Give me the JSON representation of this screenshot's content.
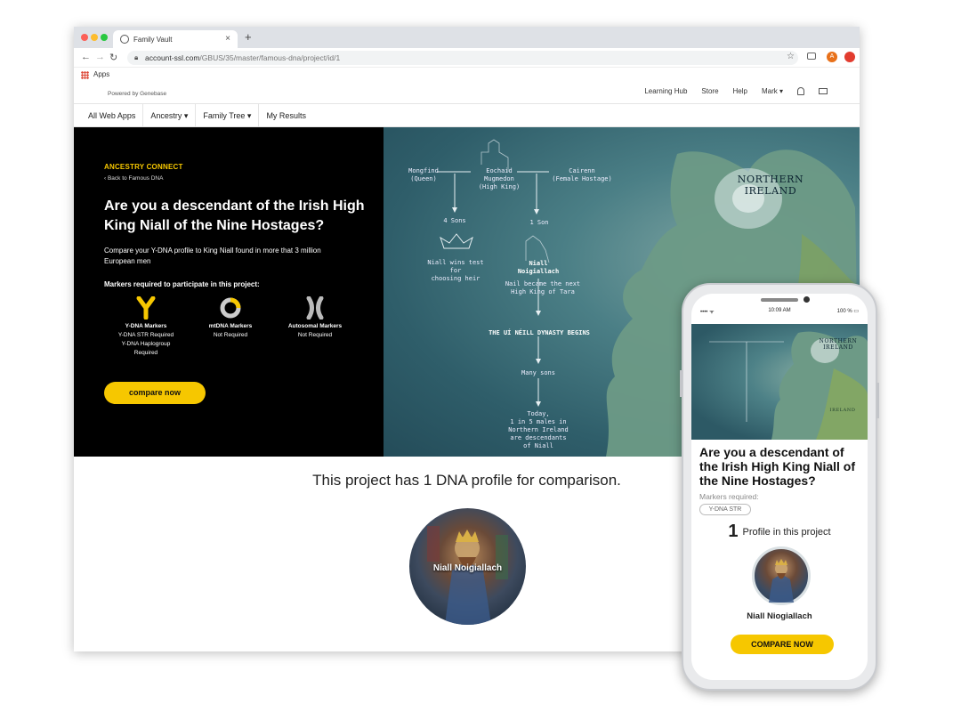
{
  "browser": {
    "tab_title": "Family Vault",
    "tab_close": "×",
    "new_tab": "+",
    "url_host": "account-ssl.com",
    "url_path": "/GBUS/35/master/famous-dna/project/id/1",
    "bookmark_apps": "Apps",
    "ext_badge": "A"
  },
  "site": {
    "powered_by": "Powered by Genebase",
    "top_nav": [
      "Learning Hub",
      "Store",
      "Help",
      "Mark ▾"
    ],
    "main_nav": [
      "All Web Apps",
      "Ancestry ▾",
      "Family Tree ▾",
      "My Results"
    ]
  },
  "hero": {
    "kicker": "ANCESTRY CONNECT",
    "back_link": "‹ Back to Famous DNA",
    "headline": "Are you a descendant of the Irish High King Niall of the Nine Hostages?",
    "subtext": "Compare your Y-DNA profile to King Niall found in more that 3 million European men",
    "markers_heading": "Markers required to participate in this project:",
    "markers": [
      {
        "title": "Y-DNA Markers",
        "lines": [
          "Y-DNA STR Required",
          "Y-DNA Haplogroup",
          "Required"
        ]
      },
      {
        "title": "mtDNA Markers",
        "lines": [
          "Not Required"
        ]
      },
      {
        "title": "Autosomal Markers",
        "lines": [
          "Not Required"
        ]
      }
    ],
    "cta": "compare now",
    "colors": {
      "accent": "#f6c700",
      "hero_bg": "#000000"
    }
  },
  "map": {
    "title": "NORTHERN\nIRELAND",
    "mongfind": "Mongfind\n(Queen)",
    "eochaid": "Eochaid\nMugmedon\n(High King)",
    "cairenn": "Cairenn\n(Female Hostage)",
    "four_sons": "4 Sons",
    "one_son": "1 Son",
    "niall_wins": "Niall wins test\nfor\nchoosing heir",
    "niall_name": "Niall\nNoigiallach",
    "niall_became": "Nail became the next\nHigh King of Tara",
    "dynasty": "THE UÍ NÉILL DYNASTY BEGINS",
    "many_sons": "Many sons",
    "today": "Today,\n1 in 5 males in\nNorthern Ireland\nare descendants\nof Niall"
  },
  "comparison": {
    "title": "This project has 1 DNA profile for comparison.",
    "profile_name": "Niall Noigiallach"
  },
  "phone": {
    "time": "10:09 AM",
    "signal": "•••• ᯤ",
    "battery": "100 % ▭",
    "map_title": "NORTHERN\nIRELAND",
    "map_label": "IRELAND",
    "title": "Are you a descendant of the Irish High King Niall of the Nine Hostages?",
    "markers_label": "Markers required:",
    "marker_pill": "Y-DNA STR",
    "count": "1",
    "count_label": "Profile in this project",
    "profile_name": "Niall Niogiallach",
    "cta": "COMPARE NOW"
  }
}
